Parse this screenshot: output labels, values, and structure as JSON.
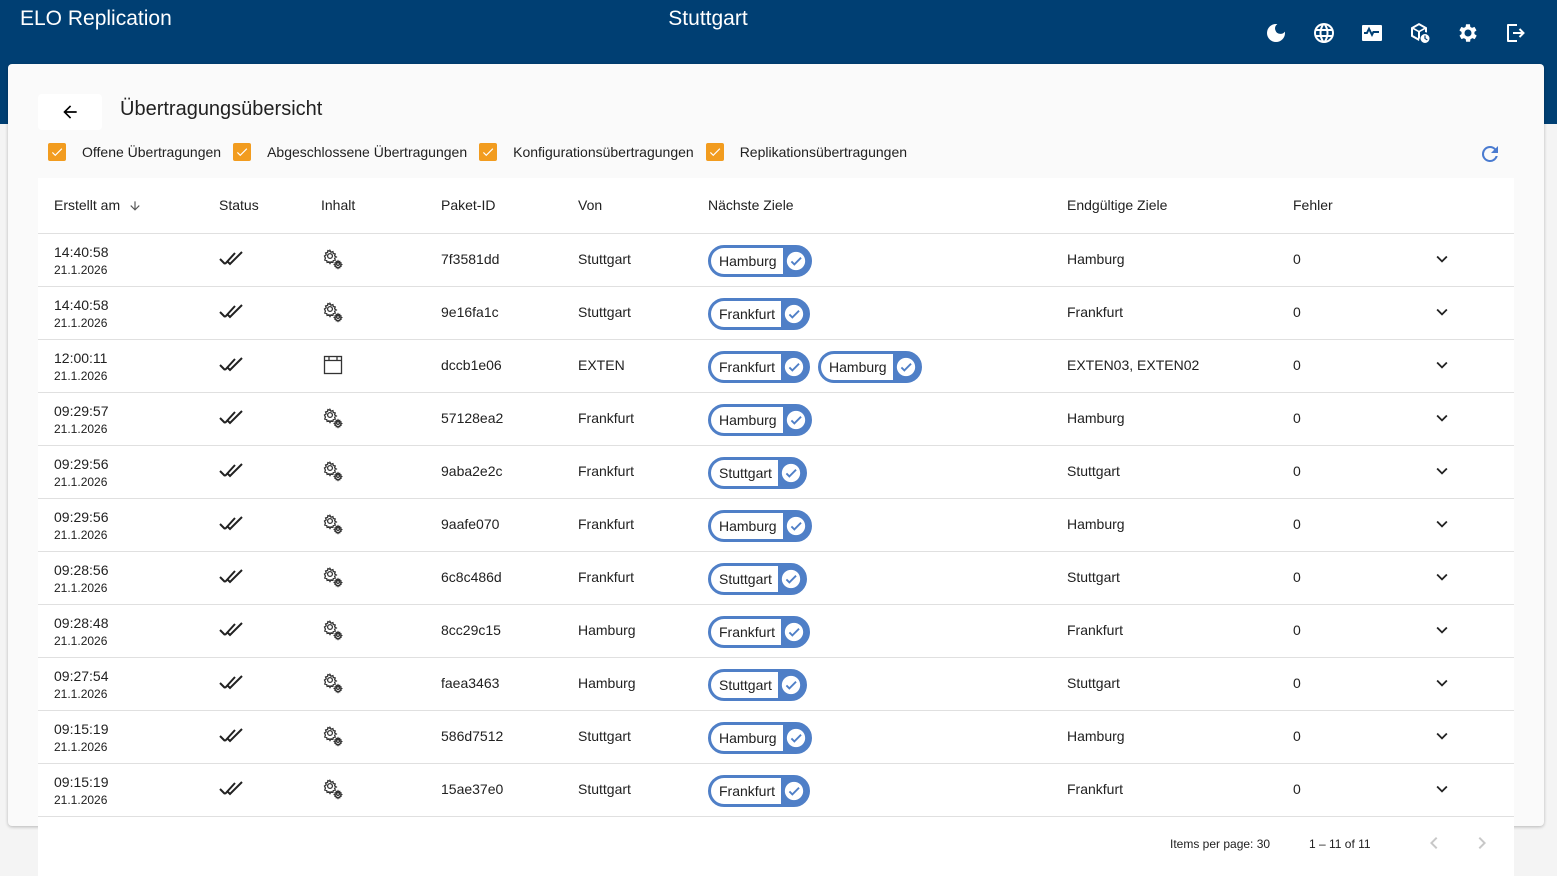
{
  "header": {
    "app_title": "ELO Replication",
    "site_title": "Stuttgart",
    "icons": [
      "dark-mode-icon",
      "language-icon",
      "monitoring-icon",
      "package-schedule-icon",
      "settings-icon",
      "logout-icon"
    ]
  },
  "page": {
    "title": "Übertragungsübersicht"
  },
  "filters": [
    {
      "label": "Offene Übertragungen",
      "checked": true
    },
    {
      "label": "Abgeschlossene Übertragungen",
      "checked": true
    },
    {
      "label": "Konfigurationsübertragungen",
      "checked": true
    },
    {
      "label": "Replikationsübertragungen",
      "checked": true
    }
  ],
  "table": {
    "columns": [
      "Erstellt am",
      "Status",
      "Inhalt",
      "Paket-ID",
      "Von",
      "Nächste Ziele",
      "Endgültige Ziele",
      "Fehler"
    ],
    "rows": [
      {
        "time": "14:40:58",
        "date": "21.1.2026",
        "status": "done-all",
        "content": "config",
        "package_id": "7f3581dd",
        "from": "Stuttgart",
        "next_targets": [
          "Hamburg"
        ],
        "final_targets": "Hamburg",
        "errors": "0"
      },
      {
        "time": "14:40:58",
        "date": "21.1.2026",
        "status": "done-all",
        "content": "config",
        "package_id": "9e16fa1c",
        "from": "Stuttgart",
        "next_targets": [
          "Frankfurt"
        ],
        "final_targets": "Frankfurt",
        "errors": "0"
      },
      {
        "time": "12:00:11",
        "date": "21.1.2026",
        "status": "done-all",
        "content": "window",
        "package_id": "dccb1e06",
        "from": "EXTEN",
        "next_targets": [
          "Frankfurt",
          "Hamburg"
        ],
        "final_targets": "EXTEN03, EXTEN02",
        "errors": "0"
      },
      {
        "time": "09:29:57",
        "date": "21.1.2026",
        "status": "done-all",
        "content": "config",
        "package_id": "57128ea2",
        "from": "Frankfurt",
        "next_targets": [
          "Hamburg"
        ],
        "final_targets": "Hamburg",
        "errors": "0"
      },
      {
        "time": "09:29:56",
        "date": "21.1.2026",
        "status": "done-all",
        "content": "config",
        "package_id": "9aba2e2c",
        "from": "Frankfurt",
        "next_targets": [
          "Stuttgart"
        ],
        "final_targets": "Stuttgart",
        "errors": "0"
      },
      {
        "time": "09:29:56",
        "date": "21.1.2026",
        "status": "done-all",
        "content": "config",
        "package_id": "9aafe070",
        "from": "Frankfurt",
        "next_targets": [
          "Hamburg"
        ],
        "final_targets": "Hamburg",
        "errors": "0"
      },
      {
        "time": "09:28:56",
        "date": "21.1.2026",
        "status": "done-all",
        "content": "config",
        "package_id": "6c8c486d",
        "from": "Frankfurt",
        "next_targets": [
          "Stuttgart"
        ],
        "final_targets": "Stuttgart",
        "errors": "0"
      },
      {
        "time": "09:28:48",
        "date": "21.1.2026",
        "status": "done-all",
        "content": "config",
        "package_id": "8cc29c15",
        "from": "Hamburg",
        "next_targets": [
          "Frankfurt"
        ],
        "final_targets": "Frankfurt",
        "errors": "0"
      },
      {
        "time": "09:27:54",
        "date": "21.1.2026",
        "status": "done-all",
        "content": "config",
        "package_id": "faea3463",
        "from": "Hamburg",
        "next_targets": [
          "Stuttgart"
        ],
        "final_targets": "Stuttgart",
        "errors": "0"
      },
      {
        "time": "09:15:19",
        "date": "21.1.2026",
        "status": "done-all",
        "content": "config",
        "package_id": "586d7512",
        "from": "Stuttgart",
        "next_targets": [
          "Hamburg"
        ],
        "final_targets": "Hamburg",
        "errors": "0"
      },
      {
        "time": "09:15:19",
        "date": "21.1.2026",
        "status": "done-all",
        "content": "config",
        "package_id": "15ae37e0",
        "from": "Stuttgart",
        "next_targets": [
          "Frankfurt"
        ],
        "final_targets": "Frankfurt",
        "errors": "0"
      }
    ]
  },
  "paginator": {
    "items_per_page": "Items per page: 30",
    "range": "1 – 11 of 11"
  },
  "colors": {
    "header_bg": "#003f73",
    "checkbox": "#f29c1f",
    "chip": "#4f7fc7",
    "refresh": "#4a7bd0"
  }
}
